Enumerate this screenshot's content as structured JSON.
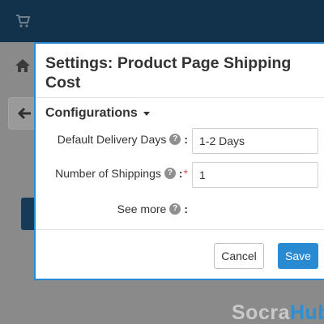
{
  "background": {
    "watermark_part1": "Socra",
    "watermark_part2": "Hub",
    "icons": [
      "cart-icon",
      "home-icon",
      "back-arrow-icon"
    ]
  },
  "modal": {
    "title": "Settings: Product Page Shipping Cost",
    "section_toggle": "Configurations",
    "fields": [
      {
        "label": "Default Delivery Days",
        "help": "?",
        "required": false,
        "value": "1-2 Days"
      },
      {
        "label": "Number of Shippings",
        "help": "?",
        "required": true,
        "required_mark": "*",
        "value": "1"
      },
      {
        "label": "See more",
        "help": "?"
      }
    ],
    "colon": ":",
    "buttons": {
      "cancel": "Cancel",
      "save": "Save"
    }
  },
  "colors": {
    "accent": "#2a8ad1",
    "topbar": "#12324b",
    "required": "#d9534f"
  }
}
